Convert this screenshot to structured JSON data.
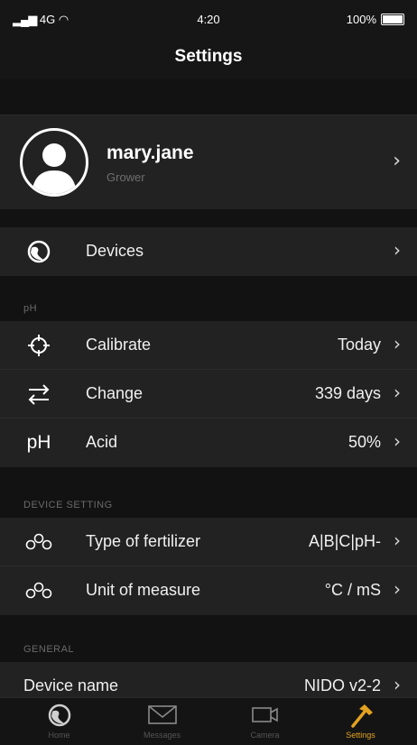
{
  "status_bar": {
    "signal": "4G",
    "time": "4:20",
    "battery": "100%"
  },
  "header": {
    "title": "Settings"
  },
  "profile": {
    "name": "mary.jane",
    "role": "Grower"
  },
  "devices_row": {
    "label": "Devices"
  },
  "sections": {
    "ph": "pH",
    "device_setting": "DEVICE SETTING",
    "general": "GENERAL"
  },
  "ph_rows": [
    {
      "label": "Calibrate",
      "value": "Today",
      "icon": "crosshair-icon"
    },
    {
      "label": "Change",
      "value": "339 days",
      "icon": "swap-arrows-icon"
    },
    {
      "label": "Acid",
      "value": "50%",
      "icon": "ph-icon",
      "icon_text": "pH"
    }
  ],
  "device_rows": [
    {
      "label": "Type of fertilizer",
      "value": "A|B|C|pH-",
      "icon": "molecule-icon"
    },
    {
      "label": "Unit of measure",
      "value": "°C / mS",
      "icon": "molecule-icon"
    }
  ],
  "general_rows": [
    {
      "label": "Device name",
      "value": "NIDO v2-2"
    }
  ],
  "tabs": [
    {
      "label": "Home",
      "icon": "home-globe-icon",
      "active": false
    },
    {
      "label": "Messages",
      "icon": "envelope-icon",
      "active": false
    },
    {
      "label": "Camera",
      "icon": "video-camera-icon",
      "active": false
    },
    {
      "label": "Settings",
      "icon": "hammer-icon",
      "active": true
    }
  ],
  "colors": {
    "accent": "#e3a21f",
    "background": "#1c1c1c",
    "row": "#222222",
    "section": "#121212"
  }
}
